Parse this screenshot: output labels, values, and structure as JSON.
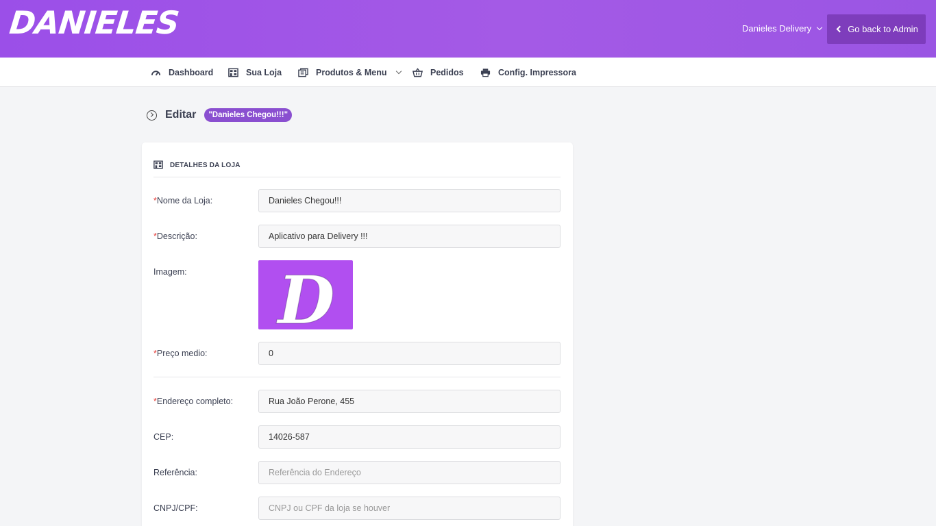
{
  "header": {
    "logo_text": "DANIELES",
    "store_selector": "Danieles Delivery",
    "back_button": "Go back to Admin",
    "colors": {
      "gradient_start": "#9b4fe8",
      "gradient_end": "#9a55e3"
    }
  },
  "nav": {
    "items": [
      {
        "label": "Dashboard",
        "icon": "speedometer-icon"
      },
      {
        "label": "Sua Loja",
        "icon": "store-icon"
      },
      {
        "label": "Produtos & Menu",
        "icon": "menu-book-icon",
        "has_dropdown": true
      },
      {
        "label": "Pedidos",
        "icon": "basket-icon"
      },
      {
        "label": "Config. Impressora",
        "icon": "printer-icon"
      }
    ]
  },
  "page": {
    "title": "Editar",
    "badge": "\"Danieles Chegou!!!\""
  },
  "card": {
    "section_title": "DETALHES DA LOJA",
    "fields": {
      "nome": {
        "label": "Nome da Loja:",
        "required": true,
        "value": "Danieles Chegou!!!"
      },
      "descricao": {
        "label": "Descrição:",
        "required": true,
        "value": "Aplicativo para Delivery !!!"
      },
      "imagem": {
        "label": "Imagem:",
        "required": false,
        "logo_letter": "D",
        "color": "#b14ff0"
      },
      "preco": {
        "label": "Preço medio:",
        "required": true,
        "value": "0"
      },
      "endereco": {
        "label": "Endereço completo:",
        "required": true,
        "value": "Rua João Perone, 455"
      },
      "cep": {
        "label": "CEP:",
        "required": false,
        "value": "14026-587"
      },
      "referencia": {
        "label": "Referência:",
        "required": false,
        "value": "",
        "placeholder": "Referência do Endereço"
      },
      "cnpj": {
        "label": "CNPJ/CPF:",
        "required": false,
        "value": "",
        "placeholder": "CNPJ ou CPF da loja se houver"
      }
    },
    "required_marker": "*"
  }
}
